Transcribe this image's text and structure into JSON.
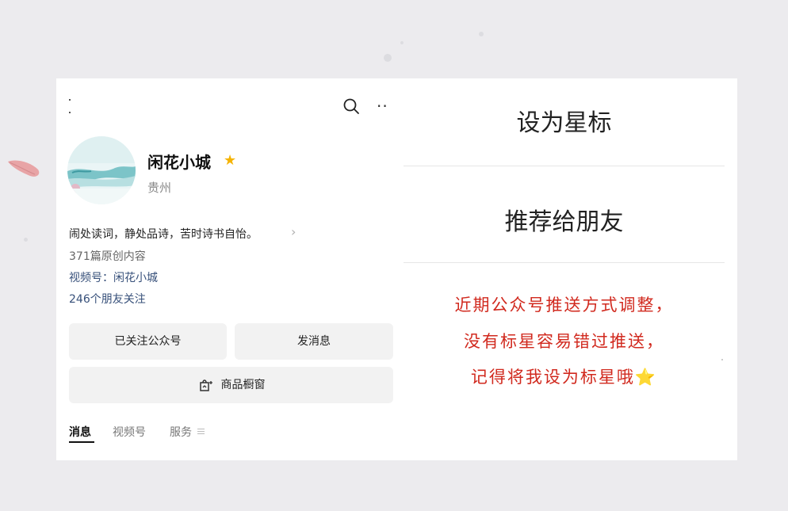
{
  "profile": {
    "name": "闲花小城",
    "location": "贵州",
    "bio": "闹处读词，静处品诗，苦时诗书自怡。",
    "stats": {
      "original_count": "371篇原创内容",
      "video_account": "视频号：闲花小城",
      "friends_following": "246个朋友关注"
    }
  },
  "buttons": {
    "follow": "已关注公众号",
    "message": "发消息",
    "shop": "商品橱窗"
  },
  "tabs": [
    "消息",
    "视频号",
    "服务"
  ],
  "menu": {
    "set_star": "设为星标",
    "recommend": "推荐给朋友"
  },
  "notice": {
    "line1": "近期公众号推送方式调整，",
    "line2": "没有标星容易错过推送，",
    "line3": "记得将我设为标星哦",
    "star": "⭐"
  },
  "colors": {
    "accent_red": "#d1291e",
    "star_yellow": "#f5b301",
    "link_blue": "#37507a"
  },
  "icons": [
    "search-icon",
    "more-icon",
    "star-icon",
    "chevron-right-icon",
    "shop-window-icon",
    "menu-icon"
  ]
}
